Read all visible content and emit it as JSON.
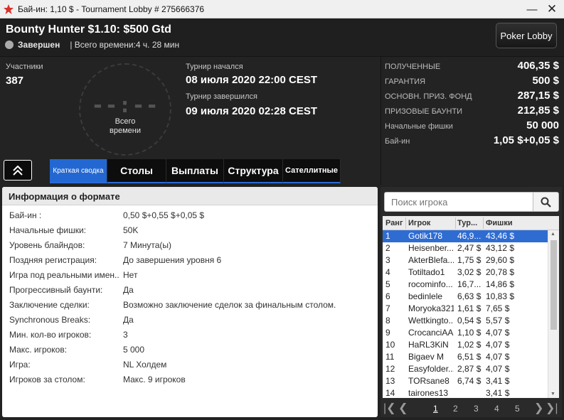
{
  "window": {
    "title": "Бай-ин: 1,10 $ - Tournament Lobby # 275666376",
    "minimize": "—",
    "close": "✕"
  },
  "header": {
    "name": "Bounty Hunter $1.10: $500 Gtd",
    "status": "Завершен",
    "total_time": "| Всего времени:4 ч. 28 мин",
    "lobby_button": "Poker Lobby"
  },
  "summary": {
    "participants_label": "Участники",
    "participants": "387",
    "clock": "--:--",
    "clock_caption_1": "Всего",
    "clock_caption_2": "времени",
    "started_label": "Турнир начался",
    "started": "08 июля 2020  22:00 CEST",
    "ended_label": "Турнир завершился",
    "ended": "09 июля 2020  02:28 CEST"
  },
  "stats": [
    {
      "label": "ПОЛУЧЕННЫЕ",
      "value": "406,35 $"
    },
    {
      "label": "ГАРАНТИЯ",
      "value": "500 $"
    },
    {
      "label": "ОСНОВН. ПРИЗ. ФОНД",
      "value": "287,15 $"
    },
    {
      "label": "ПРИЗОВЫЕ БАУНТИ",
      "value": "212,85 $"
    },
    {
      "label": "Начальные фишки",
      "value": "50 000"
    },
    {
      "label": "Бай-ин",
      "value": "1,05 $+0,05 $"
    }
  ],
  "tabs": [
    {
      "label": "Краткая сводка",
      "active": true
    },
    {
      "label": "Столы",
      "active": false
    },
    {
      "label": "Выплаты",
      "active": false
    },
    {
      "label": "Структура",
      "active": false
    },
    {
      "label": "Сателлитные",
      "active": false
    }
  ],
  "format": {
    "heading": "Информация о формате",
    "rows": [
      {
        "k": "Бай-ин :",
        "v": "0,50 $+0,55 $+0,05 $"
      },
      {
        "k": "Начальные фишки:",
        "v": "50K"
      },
      {
        "k": "Уровень блайндов:",
        "v": "7 Минута(ы)"
      },
      {
        "k": "Поздняя регистрация:",
        "v": "До завершения уровня 6"
      },
      {
        "k": "Игра под реальными имен...",
        "v": "Нет"
      },
      {
        "k": "Прогрессивный баунти:",
        "v": "Да"
      },
      {
        "k": "Заключение сделки:",
        "v": "Возможно заключение сделок за финальным столом."
      },
      {
        "k": "Synchronous Breaks:",
        "v": "Да"
      },
      {
        "k": "Мин. кол-во игроков:",
        "v": "3"
      },
      {
        "k": "Макс. игроков:",
        "v": "5 000"
      },
      {
        "k": "Игра:",
        "v": "NL Холдем"
      },
      {
        "k": "Игроков за столом:",
        "v": "Макс. 9 игроков"
      }
    ]
  },
  "players": {
    "search_placeholder": "Поиск игрока",
    "headers": {
      "rank": "Ранг",
      "player": "Игрок",
      "tur": "Тур...",
      "chips": "Фишки"
    },
    "rows": [
      {
        "rank": "1",
        "name": "Gotik178",
        "tur": "46,9...",
        "chips": "43,46 $"
      },
      {
        "rank": "2",
        "name": "Heisenber...",
        "tur": "2,47 $",
        "chips": "43,12 $"
      },
      {
        "rank": "3",
        "name": "AkterBlefa...",
        "tur": "1,75 $",
        "chips": "29,60 $"
      },
      {
        "rank": "4",
        "name": "Totiltado1",
        "tur": "3,02 $",
        "chips": "20,78 $"
      },
      {
        "rank": "5",
        "name": "rocominfo...",
        "tur": "16,7...",
        "chips": "14,86 $"
      },
      {
        "rank": "6",
        "name": "bedinlele",
        "tur": "6,63 $",
        "chips": "10,83 $"
      },
      {
        "rank": "7",
        "name": "Moryoka321",
        "tur": "1,61 $",
        "chips": "7,65 $"
      },
      {
        "rank": "8",
        "name": "Wettkingto...",
        "tur": "0,54 $",
        "chips": "5,57 $"
      },
      {
        "rank": "9",
        "name": "CrocanciAA",
        "tur": "1,10 $",
        "chips": "4,07 $"
      },
      {
        "rank": "10",
        "name": "HaRL3KiN",
        "tur": "1,02 $",
        "chips": "4,07 $"
      },
      {
        "rank": "11",
        "name": "Bigaev M",
        "tur": "6,51 $",
        "chips": "4,07 $"
      },
      {
        "rank": "12",
        "name": "Easyfolder...",
        "tur": "2,87 $",
        "chips": "4,07 $"
      },
      {
        "rank": "13",
        "name": "TORsane8",
        "tur": "6,74 $",
        "chips": "3,41 $"
      },
      {
        "rank": "14",
        "name": "tairones13",
        "tur": "",
        "chips": "3,41 $"
      }
    ],
    "pages": [
      "1",
      "2",
      "3",
      "4",
      "5"
    ],
    "current_page": "1"
  },
  "colors": {
    "accent": "#2368d2",
    "selected_row": "#2f6cd2",
    "background": "#222222"
  }
}
